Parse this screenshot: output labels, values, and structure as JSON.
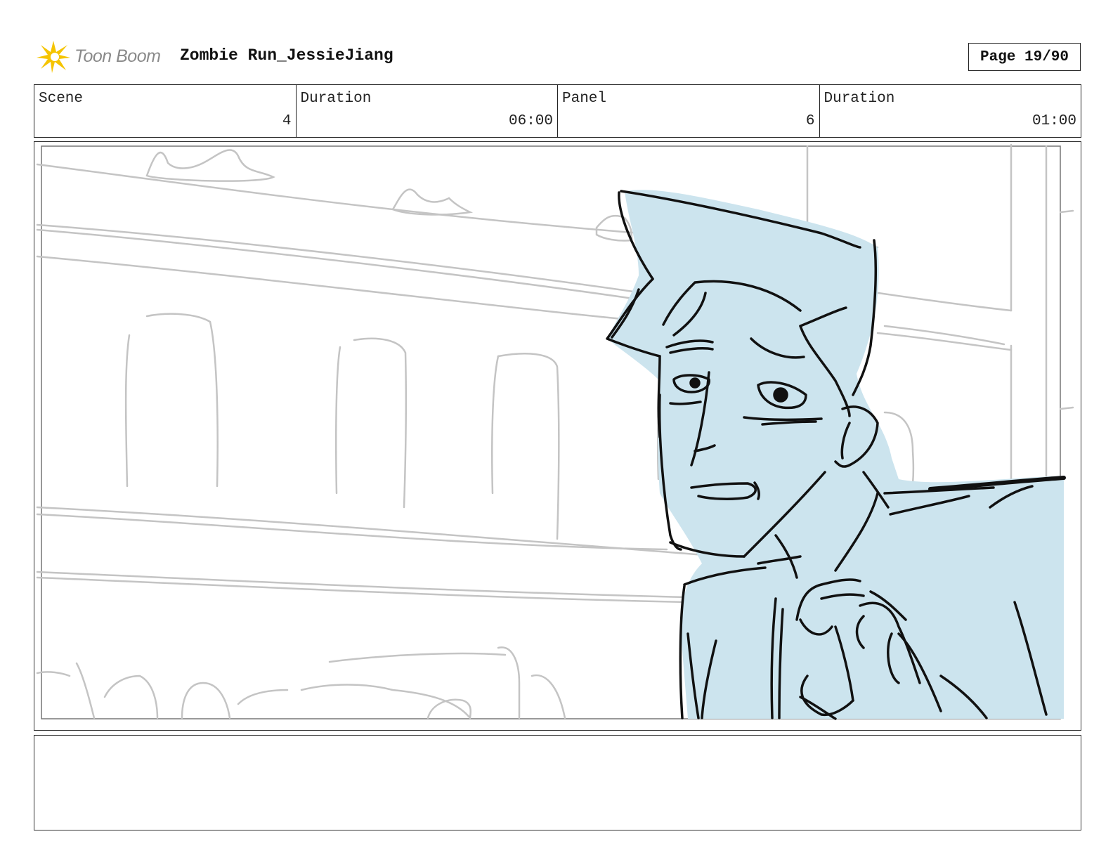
{
  "header": {
    "logo_text": "Toon Boom",
    "project_title": "Zombie Run_JessieJiang",
    "page_indicator": "Page 19/90"
  },
  "info": {
    "scene_label": "Scene",
    "scene_value": "4",
    "scene_duration_label": "Duration",
    "scene_duration_value": "06:00",
    "panel_label": "Panel",
    "panel_value": "6",
    "panel_duration_label": "Duration",
    "panel_duration_value": "01:00"
  },
  "panel": {
    "fill_color": "#cce4ee",
    "line_color": "#111111",
    "background_line_color": "#c4c4c4"
  },
  "notes": {
    "text": ""
  }
}
